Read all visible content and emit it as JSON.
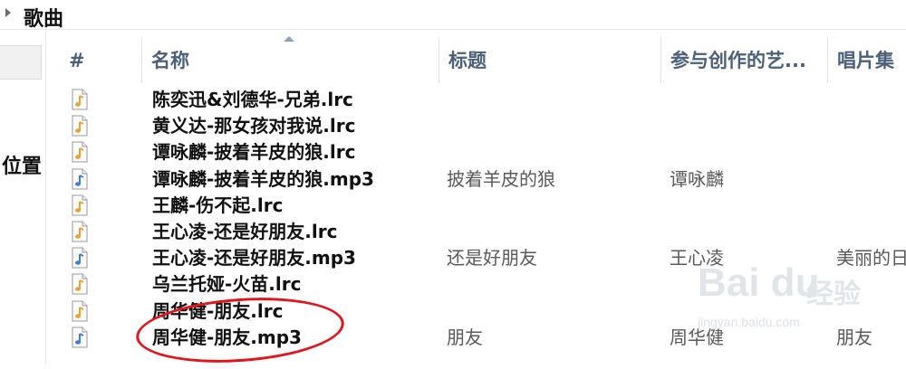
{
  "group": {
    "title": "歌曲"
  },
  "sidebar": {
    "location_label": "位置"
  },
  "columns": {
    "num": "#",
    "name": "名称",
    "title": "标题",
    "artist": "参与创作的艺...",
    "album": "唱片集"
  },
  "files": [
    {
      "name": "陈奕迅&刘德华-兄弟.lrc",
      "type": "lrc",
      "title": "",
      "artist": "",
      "album": ""
    },
    {
      "name": "黄义达-那女孩对我说.lrc",
      "type": "lrc",
      "title": "",
      "artist": "",
      "album": ""
    },
    {
      "name": "谭咏麟-披着羊皮的狼.lrc",
      "type": "lrc",
      "title": "",
      "artist": "",
      "album": ""
    },
    {
      "name": "谭咏麟-披着羊皮的狼.mp3",
      "type": "mp3",
      "title": "披着羊皮的狼",
      "artist": "谭咏麟",
      "album": ""
    },
    {
      "name": "王麟-伤不起.lrc",
      "type": "lrc",
      "title": "",
      "artist": "",
      "album": ""
    },
    {
      "name": "王心凌-还是好朋友.lrc",
      "type": "lrc",
      "title": "",
      "artist": "",
      "album": ""
    },
    {
      "name": "王心凌-还是好朋友.mp3",
      "type": "mp3",
      "title": "还是好朋友",
      "artist": "王心凌",
      "album": "美丽的日"
    },
    {
      "name": "乌兰托娅-火苗.lrc",
      "type": "lrc",
      "title": "",
      "artist": "",
      "album": ""
    },
    {
      "name": "周华健-朋友.lrc",
      "type": "lrc",
      "title": "",
      "artist": "",
      "album": ""
    },
    {
      "name": "周华健-朋友.mp3",
      "type": "mp3",
      "title": "朋友",
      "artist": "周华健",
      "album": "朋友"
    }
  ],
  "watermark": {
    "brand": "Bai du",
    "cn": "经验",
    "url": "jingyan.baidu.com"
  },
  "colors": {
    "header_text": "#4c607a",
    "annotation": "#e3141c",
    "lrc_icon": "#f0a030",
    "mp3_icon": "#3d7fd6"
  }
}
